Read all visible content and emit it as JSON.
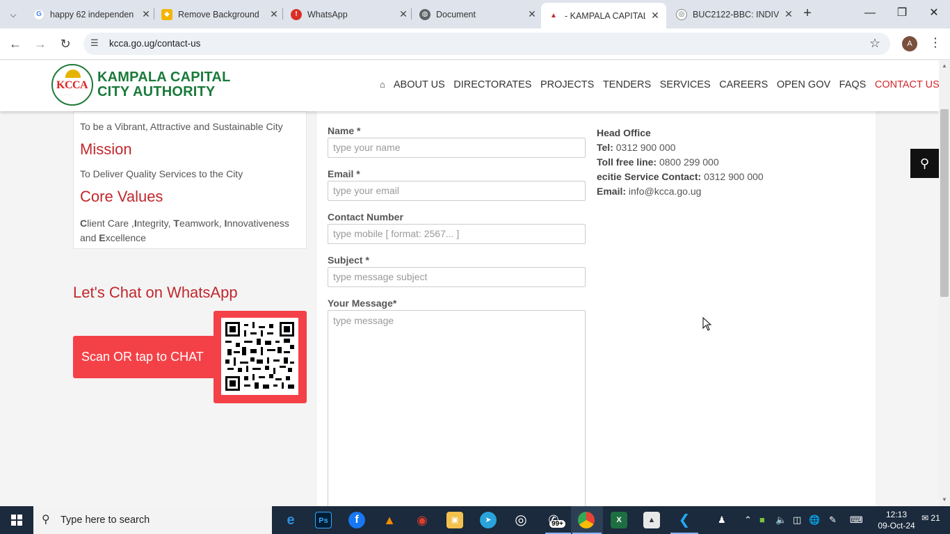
{
  "tabs": [
    {
      "title": "happy 62 independen",
      "icon": "google-icon",
      "color": "#4285f4"
    },
    {
      "title": "Remove Background",
      "icon": "removebg-icon",
      "color": "#f4b400"
    },
    {
      "title": "WhatsApp",
      "icon": "alert-icon",
      "color": "#d93025"
    },
    {
      "title": "Document",
      "icon": "globe-icon",
      "color": "#5f6368"
    },
    {
      "title": "- KAMPALA CAPITAL",
      "icon": "kcca-favicon",
      "color": "#c0282d"
    },
    {
      "title": "BUC2122-BBC: INDIV",
      "icon": "moodle-icon",
      "color": "#5f6368"
    }
  ],
  "address": {
    "url": "kcca.go.ug/contact-us",
    "profile_initial": "A"
  },
  "site": {
    "logo_line1": "KAMPALA CAPITAL",
    "logo_line2": "CITY AUTHORITY",
    "logo_abbr": "KCCA",
    "nav": [
      "ABOUT US",
      "DIRECTORATES",
      "PROJECTS",
      "TENDERS",
      "SERVICES",
      "CAREERS",
      "OPEN GOV",
      "FAQS",
      "CONTACT US"
    ],
    "active_nav": "CONTACT US",
    "accent_color": "#c0282d",
    "brand_green": "#1a7a3a"
  },
  "left": {
    "vision_text": "To be a Vibrant, Attractive and Sustainable City",
    "mission_heading": "Mission",
    "mission_text": "To Deliver Quality Services to the City",
    "core_heading": "Core Values",
    "core_text_parts": [
      {
        "b": "C",
        "t": "lient Care ,"
      },
      {
        "b": "I",
        "t": "ntegrity, "
      },
      {
        "b": "T",
        "t": "eamwork, "
      },
      {
        "b": "I",
        "t": "nnovativeness and "
      },
      {
        "b": "E",
        "t": "xcellence"
      }
    ],
    "whatsapp_heading": "Let's Chat on WhatsApp",
    "whatsapp_button": "Scan OR tap to CHAT"
  },
  "form": {
    "name_label": "Name *",
    "name_placeholder": "type your name",
    "email_label": "Email *",
    "email_placeholder": "type your email",
    "contact_label": "Contact Number",
    "contact_placeholder": "type mobile [ format: 2567... ]",
    "subject_label": "Subject *",
    "subject_placeholder": "type message subject",
    "message_label": "Your Message*",
    "message_placeholder": "type message"
  },
  "contacts": {
    "head_office": "Head Office",
    "tel_label": "Tel:",
    "tel": "0312 900 000",
    "tollfree_label": "Toll free line:",
    "tollfree": "0800 299 000",
    "ecitie_label": "ecitie Service Contact:",
    "ecitie": "0312 900 000",
    "email_label": "Email:",
    "email": "info@kcca.go.ug"
  },
  "taskbar": {
    "search_placeholder": "Type here to search",
    "whatsapp_badge": "99+",
    "time": "12:13",
    "date": "09-Oct-24",
    "notifications": "21"
  }
}
